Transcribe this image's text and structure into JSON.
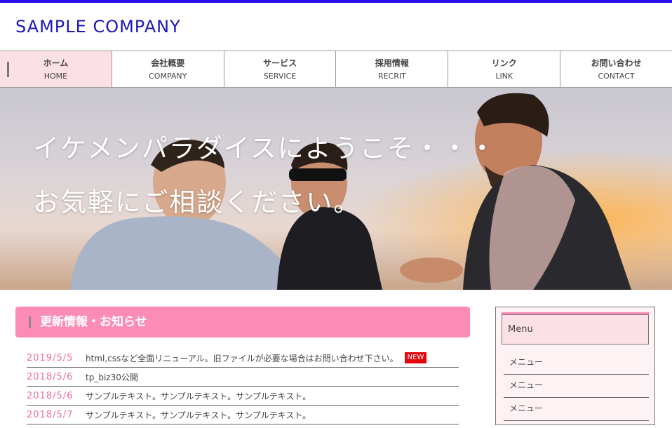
{
  "header": {
    "logo": "SAMPLE COMPANY"
  },
  "nav": [
    {
      "jp": "ホーム",
      "en": "HOME",
      "active": true
    },
    {
      "jp": "会社概要",
      "en": "COMPANY"
    },
    {
      "jp": "サービス",
      "en": "SERVICE"
    },
    {
      "jp": "採用情報",
      "en": "RECRIT"
    },
    {
      "jp": "リンク",
      "en": "LINK"
    },
    {
      "jp": "お問い合わせ",
      "en": "CONTACT"
    }
  ],
  "hero": {
    "line1": "イケメンパラダイスにようこそ・・・",
    "line2": "お気軽にご相談ください。"
  },
  "news": {
    "title": "更新情報・お知らせ",
    "items": [
      {
        "date": "2019/5/5",
        "text": "html,cssなど全面リニューアル。旧ファイルが必要な場合はお問い合わせ下さい。",
        "badge": "NEW"
      },
      {
        "date": "2018/5/6",
        "text": "tp_biz30公開"
      },
      {
        "date": "2018/5/6",
        "text": "サンプルテキスト。サンプルテキスト。サンプルテキスト。"
      },
      {
        "date": "2018/5/7",
        "text": "サンプルテキスト。サンプルテキスト。サンプルテキスト。"
      }
    ]
  },
  "sidebar": {
    "menu_title": "Menu",
    "items": [
      "メニュー",
      "メニュー",
      "メニュー"
    ]
  },
  "colors": {
    "brand_blue": "#1e16b8",
    "accent_pink": "#fc8cb5",
    "date_pink": "#f26c9d",
    "badge_red": "#e4060f"
  }
}
